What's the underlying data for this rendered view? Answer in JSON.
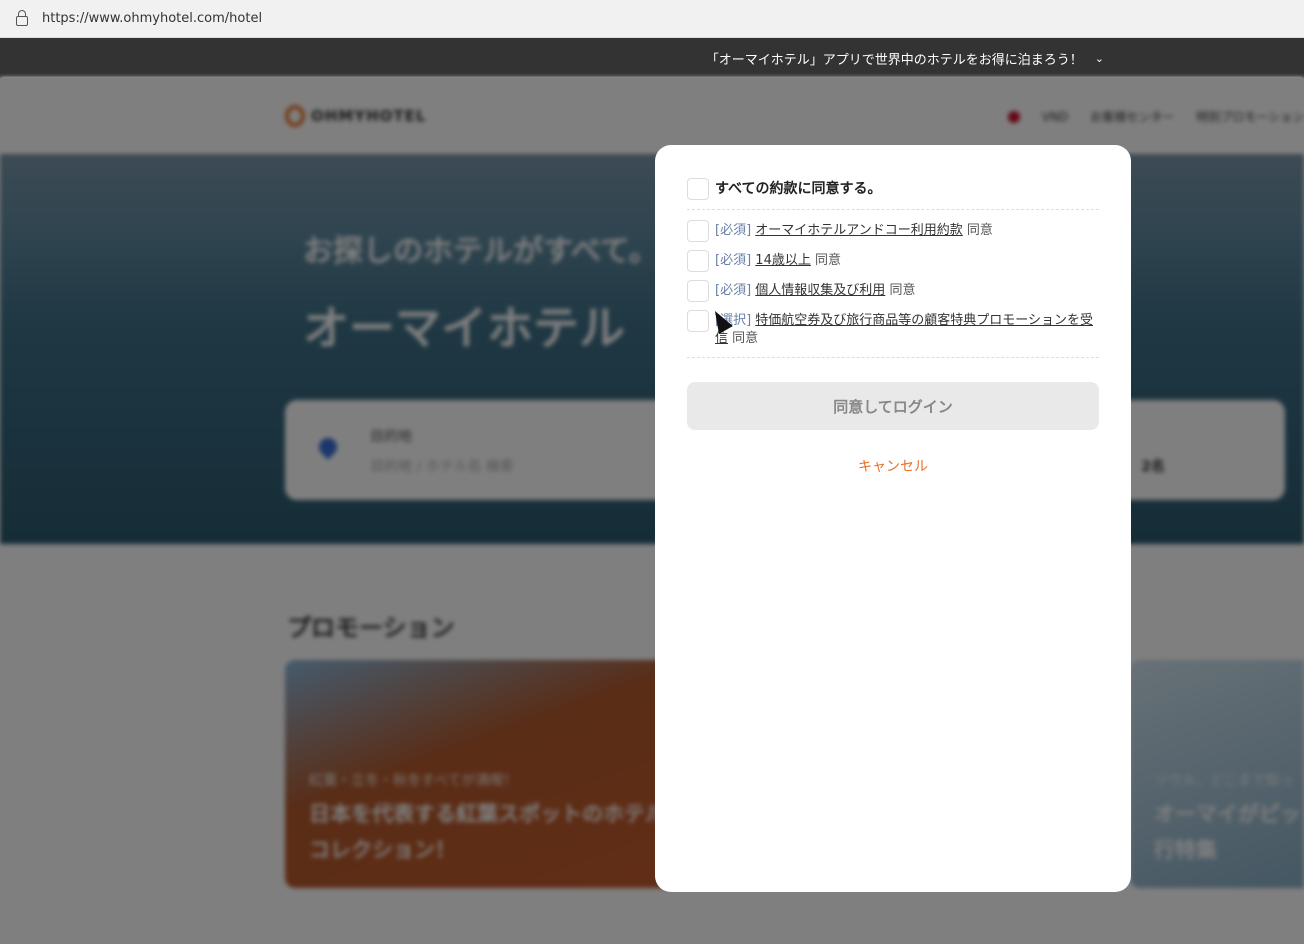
{
  "browser": {
    "url": "https://www.ohmyhotel.com/hotel"
  },
  "banner": {
    "text": "「オーマイホテル」アプリで世界中のホテルをお得に泊まろう！"
  },
  "header": {
    "logo": "OHMYHOTEL",
    "currency": "VND",
    "nav": [
      "お客様センター",
      "特別プロモーション"
    ]
  },
  "hero": {
    "subtitle": "お探しのホテルがすべて。",
    "title": "オーマイホテル"
  },
  "search": {
    "label": "目的地",
    "placeholder": "目的地 / ホテル名 検索",
    "guests": "2名"
  },
  "promotions": {
    "title": "プロモーション",
    "cards": [
      {
        "caption": "紅葉・立冬・秋冬すべてが満喫！",
        "title": "日本を代表する紅葉スポットのホテルコレクション！"
      },
      {
        "caption": "ソウル、どこまで知っ",
        "title": "オーマイがピックソウル旅行特集"
      }
    ]
  },
  "modal": {
    "agree_all": "すべての約款に同意する。",
    "terms": [
      {
        "tag": "[必須]",
        "link": "オーマイホテルアンドコー利用約款",
        "suffix": "同意"
      },
      {
        "tag": "[必須]",
        "link": "14歳以上",
        "suffix": "同意"
      },
      {
        "tag": "[必須]",
        "link": "個人情報収集及び利用",
        "suffix": "同意"
      },
      {
        "tag": "[選択]",
        "link": "特価航空券及び旅行商品等の顧客特典プロモーションを受信",
        "suffix": "同意"
      }
    ],
    "login_button": "同意してログイン",
    "cancel": "キャンセル"
  }
}
